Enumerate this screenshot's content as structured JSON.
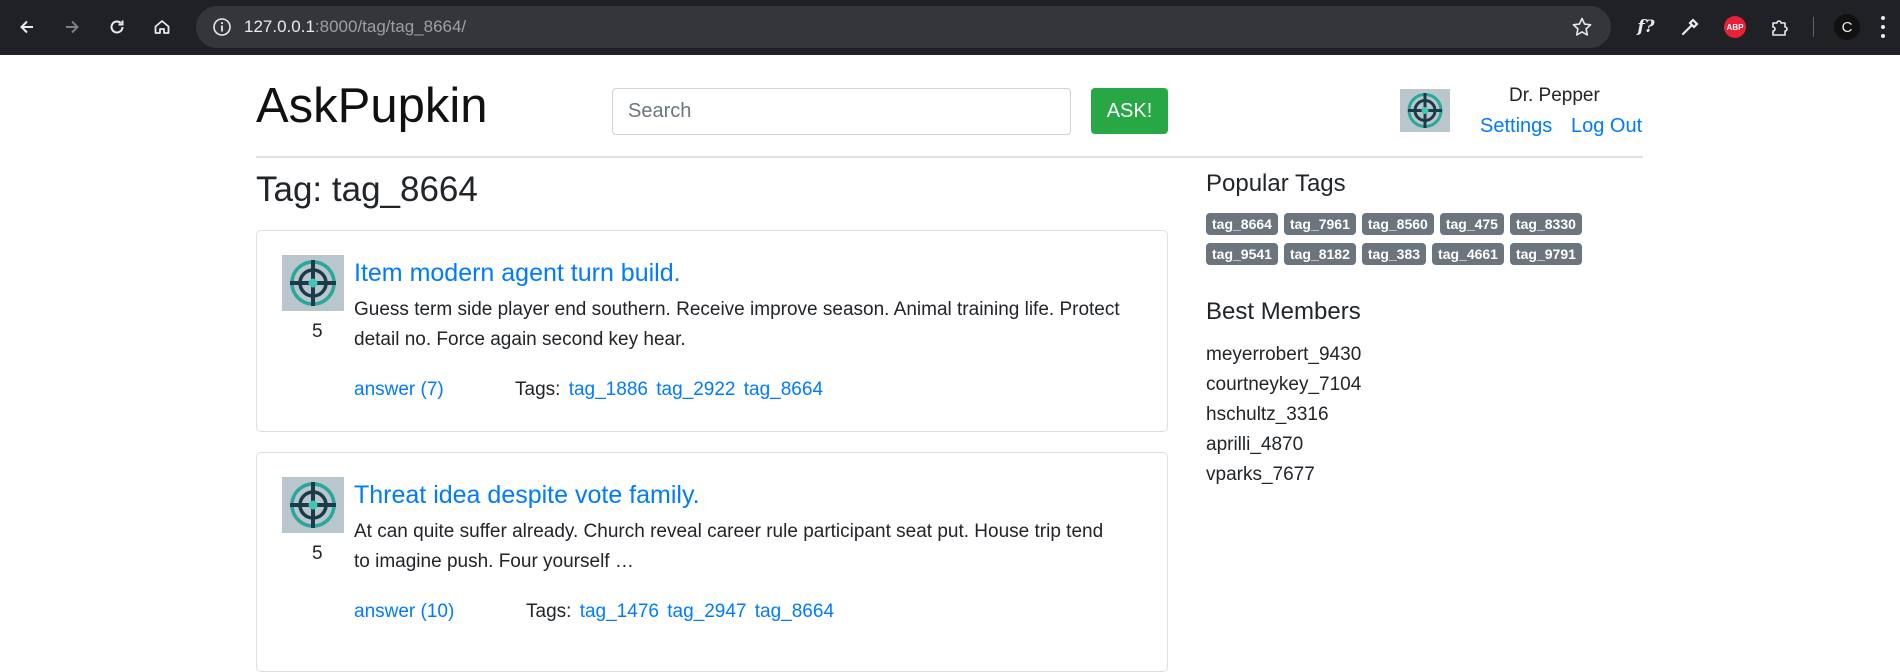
{
  "browser": {
    "url_host": "127.0.0.1",
    "url_path": ":8000/tag/tag_8664/",
    "profile_initial": "C",
    "abp_label": "ABP",
    "fx_label": "f?"
  },
  "header": {
    "logo": "AskPupkin",
    "search_placeholder": "Search",
    "ask_label": "ASK!",
    "username": "Dr. Pepper",
    "settings_label": "Settings",
    "logout_label": "Log Out"
  },
  "page_title": "Tag: tag_8664",
  "questions": [
    {
      "title": "Item modern agent turn build.",
      "text": "Guess term side player end southern. Receive improve season. Animal training life. Protect detail no. Force again second key hear.",
      "rating": "5",
      "answers_label": "answer (7)",
      "tags_label": "Tags:",
      "tags": [
        "tag_1886",
        "tag_2922",
        "tag_8664"
      ]
    },
    {
      "title": "Threat idea despite vote family.",
      "text": "At can quite suffer already. Church reveal career rule participant seat put. House trip tend to imagine push. Four yourself …",
      "rating": "5",
      "answers_label": "answer (10)",
      "tags_label": "Tags:",
      "tags": [
        "tag_1476",
        "tag_2947",
        "tag_8664"
      ]
    }
  ],
  "sidebar": {
    "popular_tags_title": "Popular Tags",
    "popular_tags": [
      "tag_8664",
      "tag_7961",
      "tag_8560",
      "tag_475",
      "tag_8330",
      "tag_9541",
      "tag_8182",
      "tag_383",
      "tag_4661",
      "tag_9791"
    ],
    "best_members_title": "Best Members",
    "best_members": [
      "meyerrobert_9430",
      "courtneykey_7104",
      "hschultz_3316",
      "aprilli_4870",
      "vparks_7677"
    ]
  },
  "colors": {
    "link": "#007bff",
    "ask_button": "#28a745",
    "badge": "#6c757d",
    "chrome_bg": "#202124"
  }
}
